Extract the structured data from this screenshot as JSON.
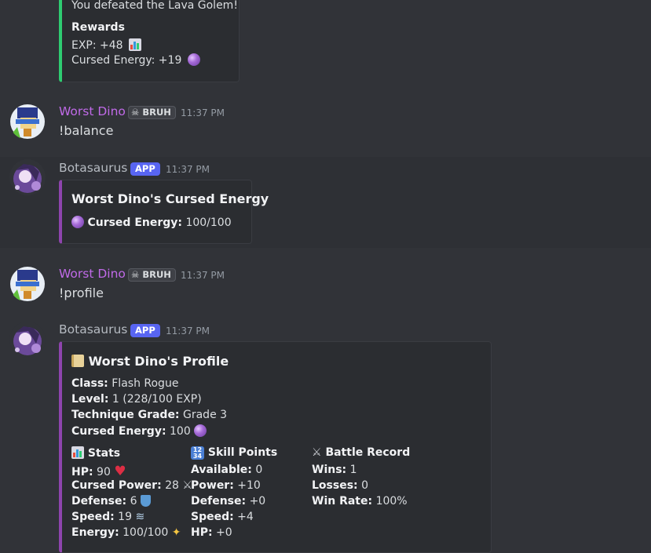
{
  "messages": {
    "prev_embed": {
      "line": "You defeated the Lava Golem!",
      "rewards_title": "Rewards",
      "exp": "EXP: +48",
      "cursed": "Cursed Energy: +19"
    },
    "m1": {
      "author": "Worst Dino",
      "tag": "BRUH",
      "time": "11:37 PM",
      "text": "!balance"
    },
    "m2": {
      "author": "Botasaurus",
      "tag": "APP",
      "time": "11:37 PM",
      "embed_title": "Worst Dino's Cursed Energy",
      "label": "Cursed Energy:",
      "value": "100/100"
    },
    "m3": {
      "author": "Worst Dino",
      "tag": "BRUH",
      "time": "11:37 PM",
      "text": "!profile"
    },
    "m4": {
      "author": "Botasaurus",
      "tag": "APP",
      "time": "11:37 PM",
      "embed_title": "Worst Dino's Profile",
      "class_label": "Class:",
      "class_value": "Flash Rogue",
      "level_label": "Level:",
      "level_value": "1 (228/100 EXP)",
      "grade_label": "Technique Grade:",
      "grade_value": "Grade 3",
      "ce_label": "Cursed Energy:",
      "ce_value": "100",
      "stats": {
        "title": "Stats",
        "hp_label": "HP:",
        "hp_value": "90",
        "cp_label": "Cursed Power:",
        "cp_value": "28",
        "def_label": "Defense:",
        "def_value": "6",
        "spd_label": "Speed:",
        "spd_value": "19",
        "en_label": "Energy:",
        "en_value": "100/100"
      },
      "skill": {
        "title": "Skill Points",
        "av_label": "Available:",
        "av_value": "0",
        "pow_label": "Power:",
        "pow_value": "+10",
        "def_label": "Defense:",
        "def_value": "+0",
        "spd_label": "Speed:",
        "spd_value": "+4",
        "hp_label": "HP:",
        "hp_value": "+0"
      },
      "battle": {
        "title": "Battle Record",
        "wins_label": "Wins:",
        "wins_value": "1",
        "loss_label": "Losses:",
        "loss_value": "0",
        "rate_label": "Win Rate:",
        "rate_value": "100%"
      }
    }
  },
  "colors": {
    "background": "#313338",
    "embed_bg": "#2b2d31",
    "username_dino": "#c06ae8",
    "app_badge": "#5865f2",
    "embed_purple": "#8e44ad",
    "embed_green": "#2ecc71"
  },
  "icons": [
    "bar-chart-icon",
    "crystal-ball-icon",
    "skull-icon",
    "scroll-icon",
    "input-numbers-icon",
    "crossed-swords-icon",
    "heart-icon",
    "shield-icon",
    "dash-icon",
    "sparkles-icon"
  ]
}
